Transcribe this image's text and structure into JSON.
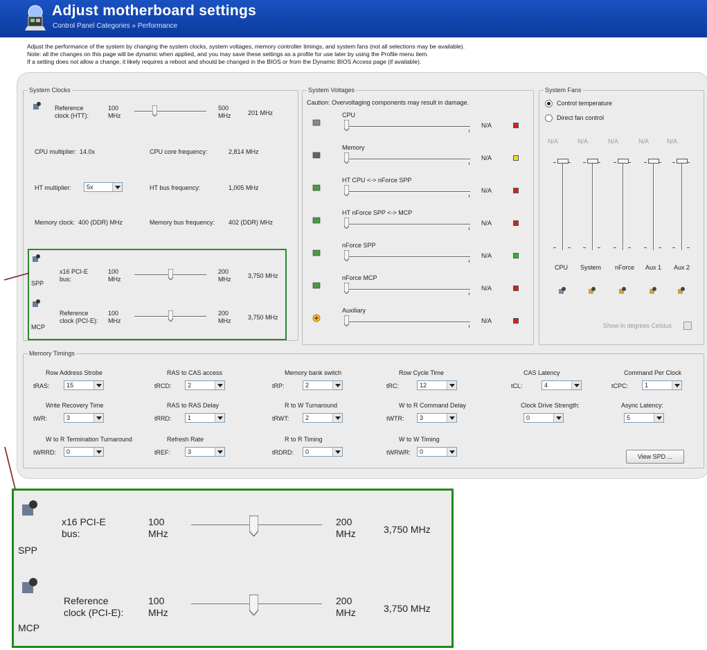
{
  "header": {
    "title": "Adjust motherboard settings",
    "breadcrumb": "Control Panel Categories  »  Performance"
  },
  "intro": [
    "Adjust the performance of the system by changing the system clocks, system voltages,  memory controller timings, and system fans (not all selections may be available).",
    "Note: all the changes on this page will be dynamic when applied, and you may save these settings as a profile for use later by using the Profile menu item.",
    "If a setting does not allow a change, it likely requires a reboot and should be changed in the BIOS or from the Dynamic BIOS Access page (if available)."
  ],
  "clocks": {
    "title": "System Clocks",
    "ref_label_1": "Reference",
    "ref_label_2": "clock (HTT):",
    "ref_min": "100",
    "ref_max": "500",
    "unit": "MHz",
    "ref_value": "201 MHz",
    "ref_pos": 0.26,
    "cpu_mult_label": "CPU multiplier:",
    "cpu_mult_value": "14.0x",
    "cpu_freq_label": "CPU core frequency:",
    "cpu_freq_value": "2,814 MHz",
    "ht_mult_label": "HT multiplier:",
    "ht_mult_value": "5x",
    "ht_freq_label": "HT bus frequency:",
    "ht_freq_value": "1,005 MHz",
    "mem_clock_label": "Memory clock:",
    "mem_clock_value": "400 (DDR) MHz",
    "mem_bus_label": "Memory bus frequency:",
    "mem_bus_value": "402 (DDR) MHz",
    "pcie_label_1": "x16 PCI-E",
    "pcie_label_2": "bus:",
    "pcie_min": "100",
    "pcie_max": "200",
    "pcie_value": "3,750 MHz",
    "pcie_pos": 0.5,
    "spp": "SPP",
    "refpcie_label_1": "Reference",
    "refpcie_label_2": "clock (PCI-E):",
    "refpcie_min": "100",
    "refpcie_max": "200",
    "refpcie_value": "3,750 MHz",
    "refpcie_pos": 0.5,
    "mcp": "MCP"
  },
  "voltages": {
    "title": "System Voltages",
    "caution": "Caution: Overvoltaging components may result in damage.",
    "rows": [
      {
        "label": "CPU",
        "value": "N/A",
        "led": "#d42020"
      },
      {
        "label": "Memory",
        "value": "N/A",
        "led": "#e8e020"
      },
      {
        "label": "HT CPU <-> nForce SPP",
        "value": "N/A",
        "led": "#d42020"
      },
      {
        "label": "HT nForce SPP <-> MCP",
        "value": "N/A",
        "led": "#d42020"
      },
      {
        "label": "nForce SPP",
        "value": "N/A",
        "led": "#20c020"
      },
      {
        "label": "nForce MCP",
        "value": "N/A",
        "led": "#d42020"
      },
      {
        "label": "Auxiliary",
        "value": "N/A",
        "led": "#d42020"
      }
    ]
  },
  "fans": {
    "title": "System Fans",
    "control_temp": "Control temperature",
    "direct": "Direct fan control",
    "names": [
      "CPU",
      "System",
      "nForce",
      "Aux 1",
      "Aux 2"
    ],
    "values": [
      "N/A",
      "N/A",
      "N/A",
      "N/A",
      "N/A"
    ],
    "celsius": "Show in degrees Celsius"
  },
  "memory": {
    "title": "Memory Timings",
    "items": [
      {
        "header": "Row Address Strobe",
        "label": "tRAS:",
        "value": "15"
      },
      {
        "header": "RAS to CAS access",
        "label": "tRCD:",
        "value": "2"
      },
      {
        "header": "Memory bank switch",
        "label": "tRP:",
        "value": "2"
      },
      {
        "header": "Row Cycle Time",
        "label": "tRC:",
        "value": "12"
      },
      {
        "header": "CAS Latency",
        "label": "tCL:",
        "value": "4"
      },
      {
        "header": "Command Per Clock",
        "label": "tCPC:",
        "value": "1"
      },
      {
        "header": "Write Recovery Time",
        "label": "tWR:",
        "value": "3"
      },
      {
        "header": "RAS to RAS Delay",
        "label": "tRRD:",
        "value": "1"
      },
      {
        "header": "R to W Turnaround",
        "label": "tRWT:",
        "value": "2"
      },
      {
        "header": "W to R Command Delay",
        "label": "tWTR:",
        "value": "3"
      },
      {
        "header": "Clock Drive Strength:",
        "label": "",
        "value": "0"
      },
      {
        "header": "Async Latency:",
        "label": "",
        "value": "5"
      },
      {
        "header": "W to R Termination Turnaround",
        "label": "tWRRD:",
        "value": "0"
      },
      {
        "header": "Refresh Rate",
        "label": "tREF:",
        "value": "3"
      },
      {
        "header": "R to R Timing",
        "label": "tRDRD:",
        "value": "0"
      },
      {
        "header": "W to W Timing",
        "label": "tWRWR:",
        "value": "0"
      }
    ],
    "view_spd": "View SPD ..."
  },
  "colors": {
    "header_bg": "#1a52c2",
    "highlight": "#2a8a2a"
  }
}
